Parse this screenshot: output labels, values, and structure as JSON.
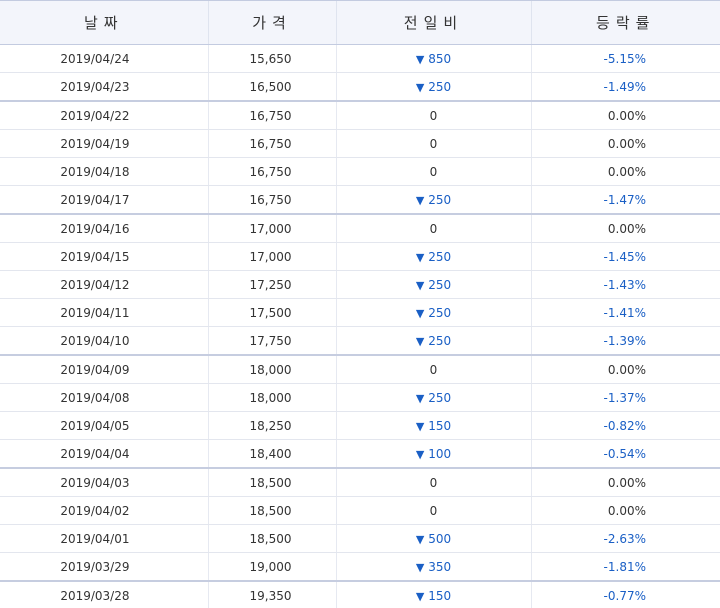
{
  "header": {
    "date": "날짜",
    "price": "가격",
    "change": "전일비",
    "rate": "등락률"
  },
  "rows": [
    {
      "date": "2019/04/24",
      "price": "15,650",
      "change": "850",
      "down": true,
      "rate": "-5.15%"
    },
    {
      "date": "2019/04/23",
      "price": "16,500",
      "change": "250",
      "down": true,
      "rate": "-1.49%"
    },
    {
      "date": "2019/04/22",
      "price": "16,750",
      "change": "0",
      "down": false,
      "rate": "0.00%"
    },
    {
      "date": "2019/04/19",
      "price": "16,750",
      "change": "0",
      "down": false,
      "rate": "0.00%"
    },
    {
      "date": "2019/04/18",
      "price": "16,750",
      "change": "0",
      "down": false,
      "rate": "0.00%"
    },
    {
      "date": "2019/04/17",
      "price": "16,750",
      "change": "250",
      "down": true,
      "rate": "-1.47%"
    },
    {
      "date": "2019/04/16",
      "price": "17,000",
      "change": "0",
      "down": false,
      "rate": "0.00%"
    },
    {
      "date": "2019/04/15",
      "price": "17,000",
      "change": "250",
      "down": true,
      "rate": "-1.45%"
    },
    {
      "date": "2019/04/12",
      "price": "17,250",
      "change": "250",
      "down": true,
      "rate": "-1.43%"
    },
    {
      "date": "2019/04/11",
      "price": "17,500",
      "change": "250",
      "down": true,
      "rate": "-1.41%"
    },
    {
      "date": "2019/04/10",
      "price": "17,750",
      "change": "250",
      "down": true,
      "rate": "-1.39%"
    },
    {
      "date": "2019/04/09",
      "price": "18,000",
      "change": "0",
      "down": false,
      "rate": "0.00%"
    },
    {
      "date": "2019/04/08",
      "price": "18,000",
      "change": "250",
      "down": true,
      "rate": "-1.37%"
    },
    {
      "date": "2019/04/05",
      "price": "18,250",
      "change": "150",
      "down": true,
      "rate": "-0.82%"
    },
    {
      "date": "2019/04/04",
      "price": "18,400",
      "change": "100",
      "down": true,
      "rate": "-0.54%"
    },
    {
      "date": "2019/04/03",
      "price": "18,500",
      "change": "0",
      "down": false,
      "rate": "0.00%"
    },
    {
      "date": "2019/04/02",
      "price": "18,500",
      "change": "0",
      "down": false,
      "rate": "0.00%"
    },
    {
      "date": "2019/04/01",
      "price": "18,500",
      "change": "500",
      "down": true,
      "rate": "-2.63%"
    },
    {
      "date": "2019/03/29",
      "price": "19,000",
      "change": "350",
      "down": true,
      "rate": "-1.81%"
    },
    {
      "date": "2019/03/28",
      "price": "19,350",
      "change": "150",
      "down": true,
      "rate": "-0.77%"
    }
  ],
  "colors": {
    "down": "#1a5fc5",
    "header_bg": "#f3f5fb",
    "text": "#333333"
  }
}
